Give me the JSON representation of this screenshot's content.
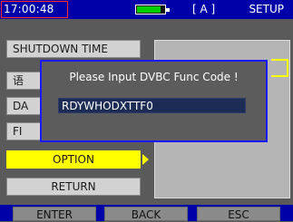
{
  "status_bar": {
    "time": "17:00:48",
    "battery_level": 0.85,
    "channel": "[ A ]",
    "mode": "SETUP"
  },
  "menu": {
    "items": [
      {
        "label": "SHUTDOWN TIME"
      },
      {
        "label": "语"
      },
      {
        "label": "DA"
      },
      {
        "label": "FI"
      },
      {
        "label": "OPTION"
      },
      {
        "label": "RETURN"
      }
    ]
  },
  "dialog": {
    "message": "Please Input DVBC Func Code !",
    "input_value": "RDYWHODXTTF0"
  },
  "softkeys": {
    "enter": "ENTER",
    "back": "BACK",
    "esc": "ESC"
  },
  "colors": {
    "bar_blue": "#0000a8",
    "highlight_yellow": "#ffff00",
    "dialog_border": "#1a1aff"
  }
}
